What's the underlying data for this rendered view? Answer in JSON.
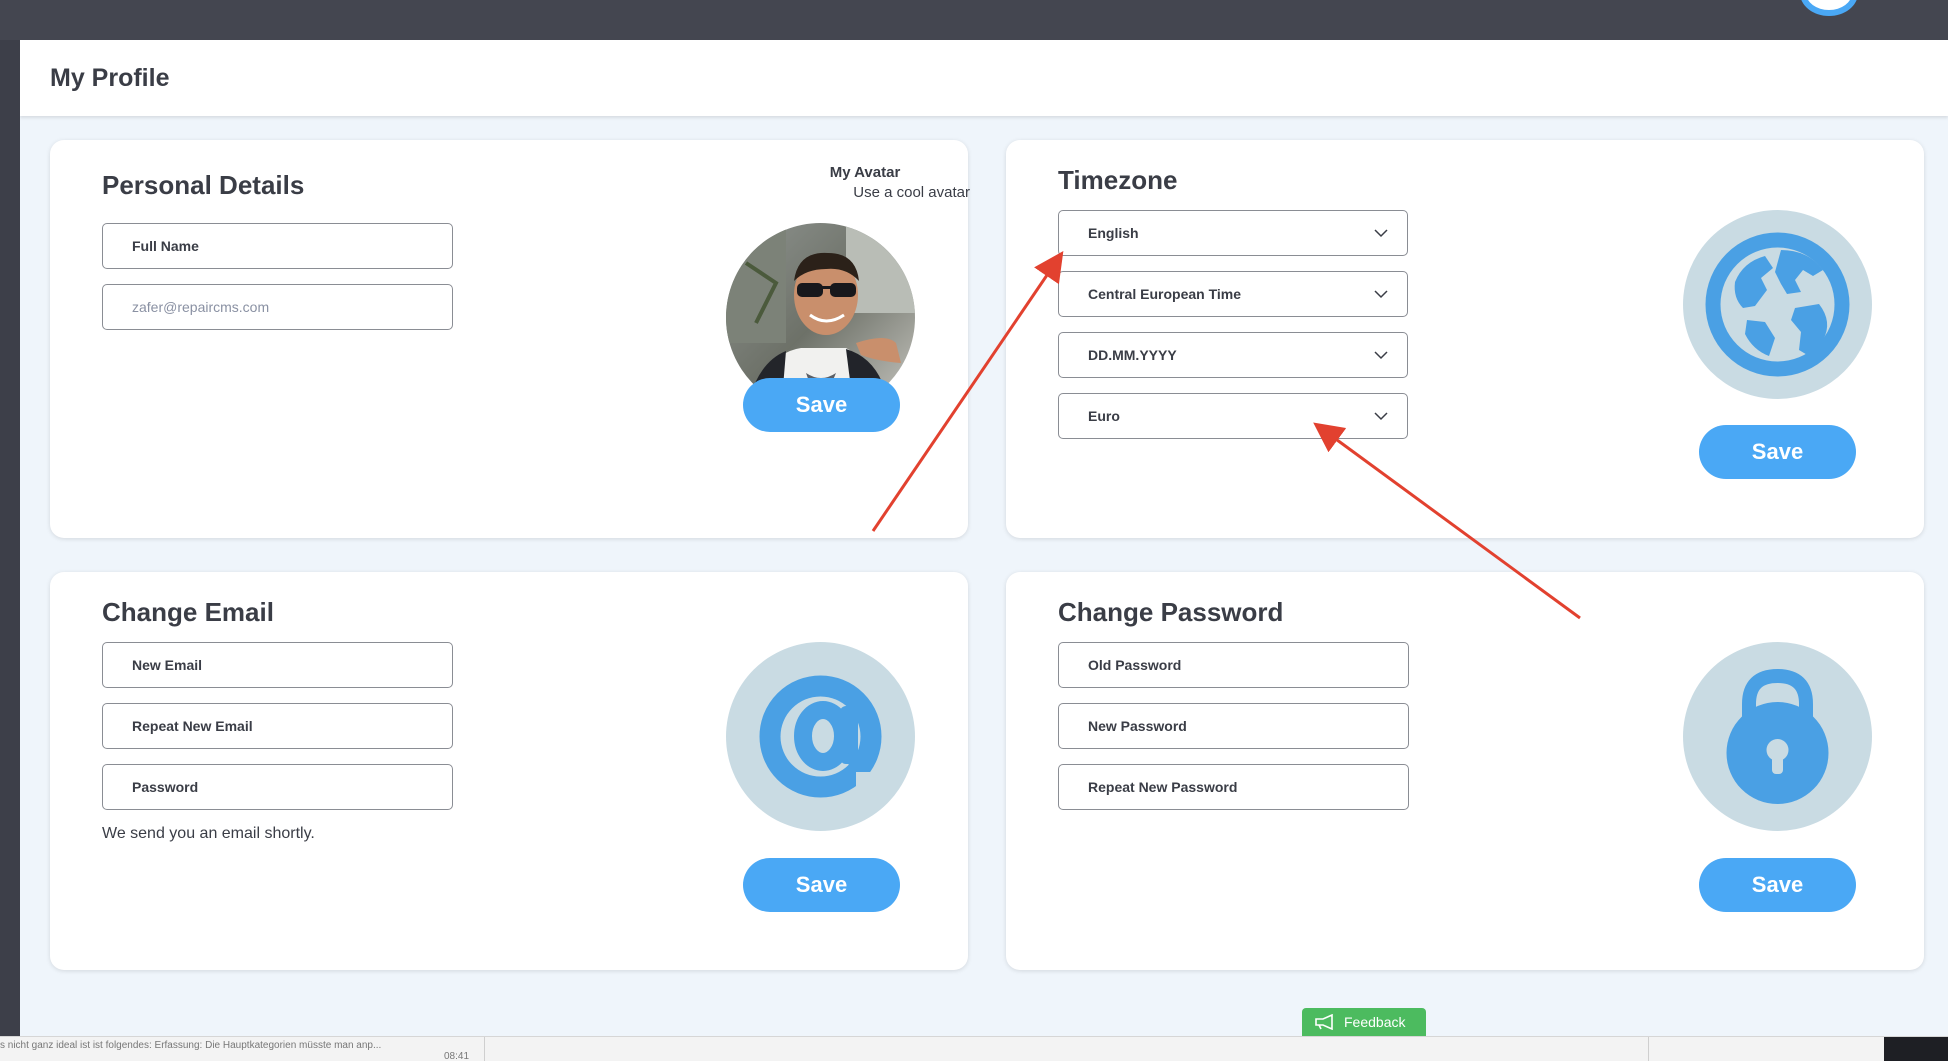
{
  "header": {
    "title": "My Profile"
  },
  "personal_details": {
    "title": "Personal Details",
    "full_name_label": "Full Name",
    "email_placeholder": "zafer@repaircms.com",
    "avatar_title": "My Avatar",
    "avatar_subtitle": "Use a cool avatar",
    "save_label": "Save"
  },
  "timezone": {
    "title": "Timezone",
    "language_value": "English",
    "timezone_value": "Central European Time",
    "date_format_value": "DD.MM.YYYY",
    "currency_value": "Euro",
    "save_label": "Save"
  },
  "change_email": {
    "title": "Change Email",
    "new_email_label": "New Email",
    "repeat_email_label": "Repeat New Email",
    "password_label": "Password",
    "note": "We send you an email shortly.",
    "save_label": "Save"
  },
  "change_password": {
    "title": "Change Password",
    "old_password_label": "Old Password",
    "new_password_label": "New Password",
    "repeat_password_label": "Repeat New Password",
    "save_label": "Save"
  },
  "feedback": {
    "label": "Feedback"
  },
  "bottom_bar": {
    "snippet": "s nicht ganz ideal ist ist folgendes: Erfassung: Die Hauptkategorien müsste man anp...",
    "time": "08:41"
  },
  "icons": {
    "globe": "globe-icon",
    "at": "at-sign-icon",
    "lock": "lock-icon",
    "chevron": "chevron-down-icon"
  },
  "colors": {
    "accent": "#4aa8f5",
    "icon_bg": "#c9dbe3",
    "page_bg": "#eff5fb",
    "topbar": "#444650",
    "annotation": "#e2412f",
    "feedback": "#4cbb5f"
  }
}
